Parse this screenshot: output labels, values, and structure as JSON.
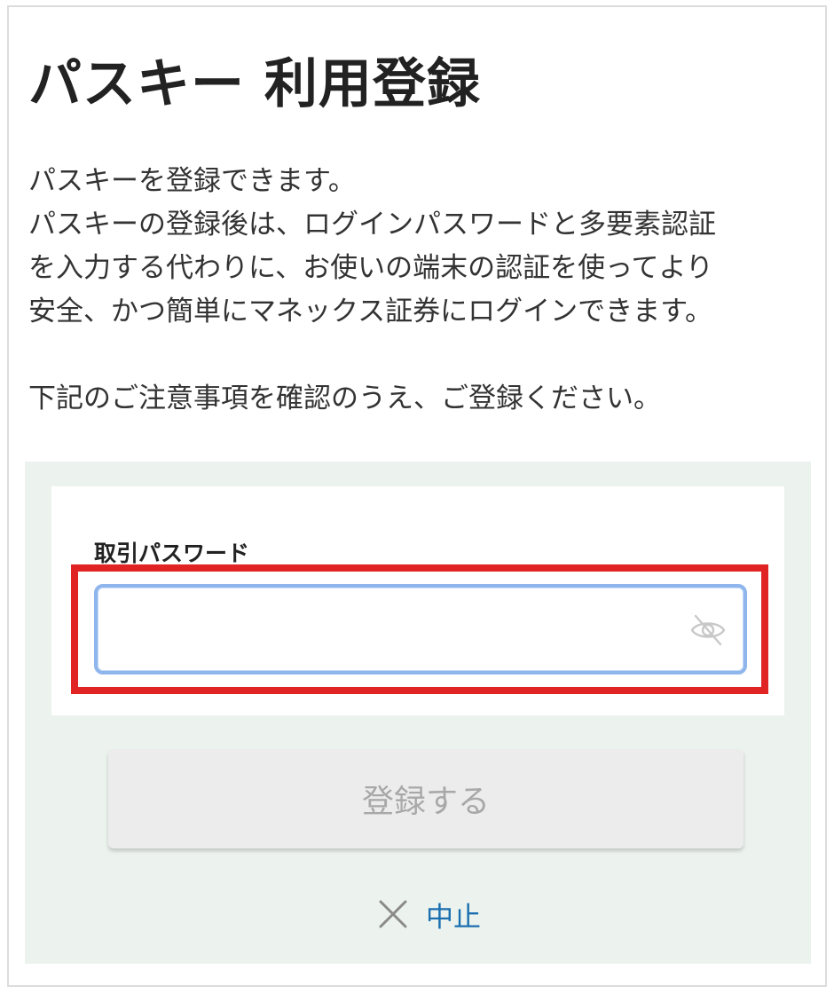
{
  "page": {
    "title": "パスキー 利用登録",
    "intro_lines": [
      "パスキーを登録できます。",
      "パスキーの登録後は、ログインパスワードと多要素認証",
      "を入力する代わりに、お使いの端末の認証を使ってより",
      "安全、かつ簡単にマネックス証券にログインできます。"
    ],
    "notice": "下記のご注意事項を確認のうえ、ご登録ください。"
  },
  "form": {
    "password_label": "取引パスワード",
    "password_value": "",
    "visibility_icon": "eye-off-icon",
    "submit_label": "登録する",
    "cancel_icon": "close-icon",
    "cancel_label": "中止"
  },
  "colors": {
    "panel_bg": "#ecf3ee",
    "highlight": "#e02424",
    "input_focus": "#8fb6ec",
    "link": "#1a6fb0",
    "button_disabled_bg": "#ececec",
    "button_disabled_text": "#a8a8a8"
  }
}
